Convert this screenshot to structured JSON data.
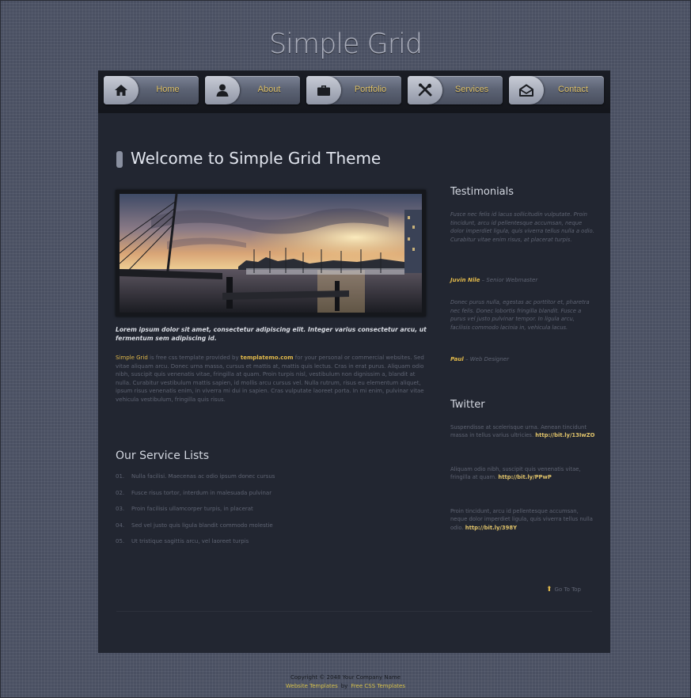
{
  "site": {
    "title": "Simple Grid"
  },
  "nav": {
    "items": [
      {
        "label": "Home",
        "icon": "home-icon"
      },
      {
        "label": "About",
        "icon": "user-icon"
      },
      {
        "label": "Portfolio",
        "icon": "briefcase-icon"
      },
      {
        "label": "Services",
        "icon": "tools-icon"
      },
      {
        "label": "Contact",
        "icon": "envelope-icon"
      }
    ]
  },
  "main": {
    "title": "Welcome to Simple Grid Theme",
    "caption": "Lorem ipsum dolor sit amet, consectetur adipiscing elit. Integer varius consectetur arcu, ut fermentum sem adipiscing id.",
    "intro": {
      "brand": "Simple Grid",
      "text1": " is free css template provided by ",
      "link": "templatemo.com",
      "text2": " for your personal or commercial websites. Sed vitae aliquam arcu. Donec urna massa, cursus et mattis at, mattis quis lectus. Cras in erat purus. Aliquam odio nibh, suscipit quis venenatis vitae, fringilla at quam. Proin turpis nisl, vestibulum non dignissim a, blandit at nulla. Curabitur vestibulum mattis sapien, id mollis arcu cursus vel. Nulla rutrum, risus eu elementum aliquet, ipsum risus venenatis enim, in viverra mi dui in sapien. Cras vulputate laoreet porta. In mi enim, pulvinar vitae vehicula vestibulum, fringilla quis risus."
    },
    "services": {
      "title": "Our Service Lists",
      "items": [
        {
          "num": "01.",
          "text": "Nulla facilisi. Maecenas ac odio ipsum donec cursus"
        },
        {
          "num": "02.",
          "text": "Fusce risus tortor, interdum in malesuada pulvinar"
        },
        {
          "num": "03.",
          "text": "Proin facilisis ullamcorper turpis, in placerat"
        },
        {
          "num": "04.",
          "text": "Sed vel justo quis ligula blandit commodo molestie"
        },
        {
          "num": "05.",
          "text": "Ut tristique sagittis arcu, vel laoreet turpis"
        }
      ]
    }
  },
  "sidebar": {
    "testimonials": {
      "title": "Testimonials",
      "items": [
        {
          "quote": "Fusce nec felis id lacus sollicitudin vulputate. Proin tincidunt, arcu id pellentesque accumsan, neque dolor imperdiet ligula, quis viverra tellus nulla a odio. Curabitur vitae enim risus, at placerat turpis.",
          "author": "Juvin Nile",
          "role": " – Senior Webmaster"
        },
        {
          "quote": "Donec purus nulla, egestas ac porttitor et, pharetra nec felis. Donec lobortis fringilla blandit. Fusce a purus vel justo pulvinar tempor. In ligula arcu, facilisis commodo lacinia in, vehicula lacus.",
          "author": "Paul",
          "role": " – Web Designer"
        }
      ]
    },
    "twitter": {
      "title": "Twitter",
      "items": [
        {
          "text": "Suspendisse at scelerisque urna. Aenean tincidunt massa in tellus varius ultricies. ",
          "link": "http://bit.ly/13IwZO"
        },
        {
          "text": "Aliquam odio nibh, suscipit quis venenatis vitae, fringilla at quam. ",
          "link": "http://bit.ly/PPwP"
        },
        {
          "text": "Proin tincidunt, arcu id pellentesque accumsan, neque dolor imperdiet ligula, quis viverra tellus nulla odio. ",
          "link": "http://bit.ly/398Y"
        }
      ]
    }
  },
  "go_top": "Go To Top",
  "footer": {
    "copyright": "Copyright © 2048 Your Company Name",
    "link1": "Website Templates",
    "separator": "by",
    "link2": "Free CSS Templates"
  },
  "colors": {
    "accent": "#e0b84a",
    "container_bg": "#222631",
    "page_bg": "#4a5062"
  }
}
